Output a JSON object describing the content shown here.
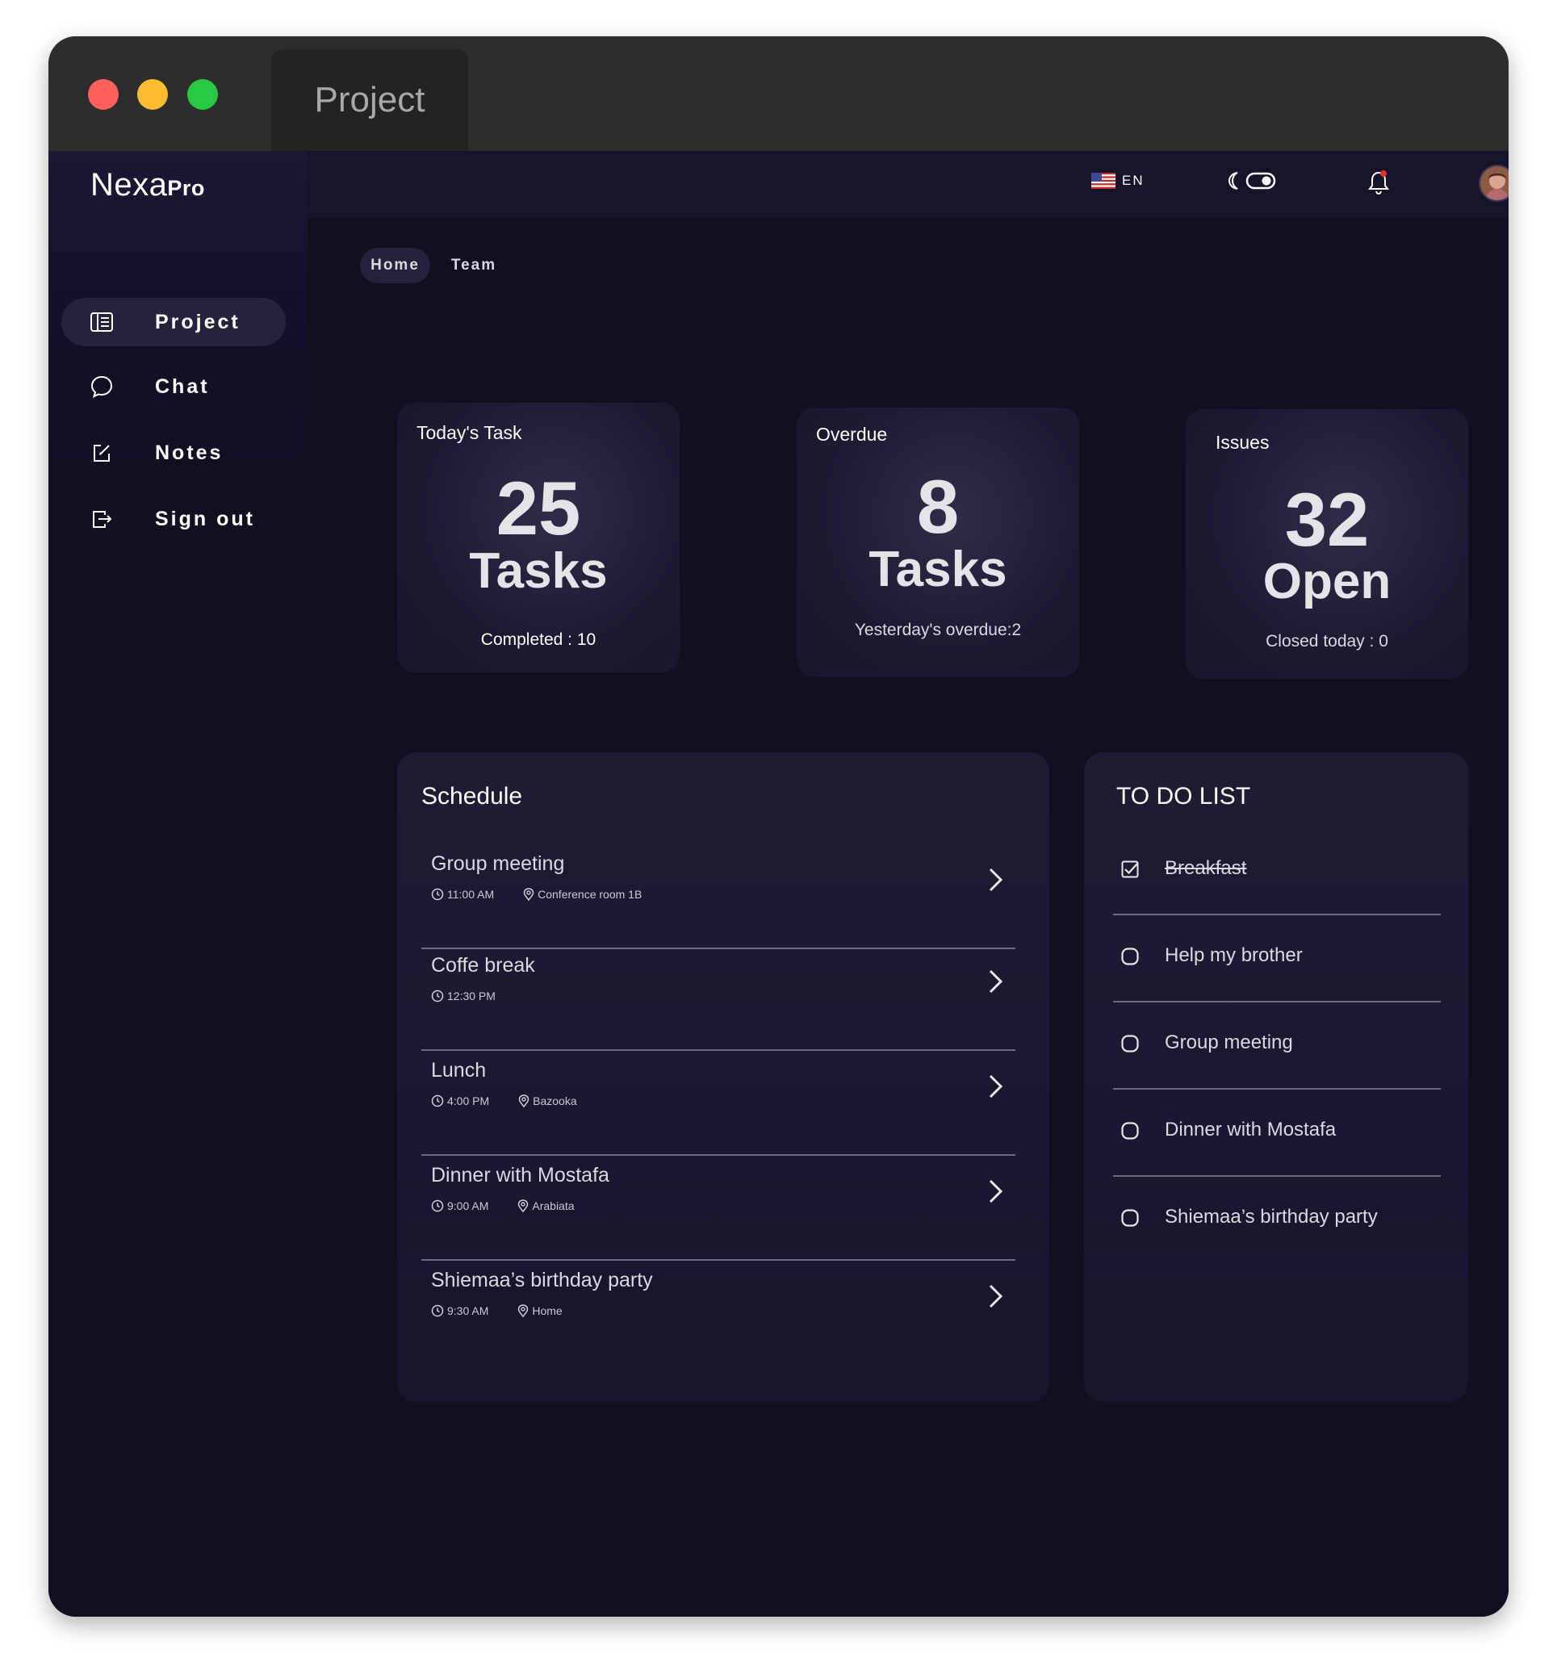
{
  "window": {
    "tab_title": "Project"
  },
  "sidebar": {
    "brand_main": "Nexa",
    "brand_suffix": "Pro",
    "items": [
      {
        "label": "Project",
        "icon": "project-icon",
        "active": true
      },
      {
        "label": "Chat",
        "icon": "chat-icon",
        "active": false
      },
      {
        "label": "Notes",
        "icon": "notes-icon",
        "active": false
      },
      {
        "label": "Sign out",
        "icon": "sign-out-icon",
        "active": false
      }
    ]
  },
  "topbar": {
    "language": "EN",
    "flag_icon": "us-flag-icon",
    "theme_icons": [
      "moon-icon",
      "toggle-icon"
    ],
    "notification_icon": "bell-icon",
    "notification_dot_color": "#e5322d",
    "avatar_icon": "avatar"
  },
  "breadcrumbs": [
    {
      "label": "Home",
      "active": true
    },
    {
      "label": "Team",
      "active": false
    }
  ],
  "stats": [
    {
      "title": "Today's Task",
      "number": "25",
      "unit": "Tasks",
      "footer": "Completed : 10"
    },
    {
      "title": "Overdue",
      "number": "8",
      "unit": "Tasks",
      "footer": "Yesterday's overdue:2"
    },
    {
      "title": "Issues",
      "number": "32",
      "unit": "Open",
      "footer": "Closed today : 0"
    }
  ],
  "schedule": {
    "title": "Schedule",
    "items": [
      {
        "title": "Group meeting",
        "time": "11:00 AM",
        "location": "Conference room 1B"
      },
      {
        "title": "Coffe break",
        "time": "12:30 PM",
        "location": ""
      },
      {
        "title": "Lunch",
        "time": "4:00 PM",
        "location": "Bazooka"
      },
      {
        "title": "Dinner with Mostafa",
        "time": "9:00 AM",
        "location": "Arabiata"
      },
      {
        "title": "Shiemaa’s birthday party",
        "time": "9:30 AM",
        "location": "Home"
      }
    ]
  },
  "todo": {
    "title": "TO DO LIST",
    "items": [
      {
        "label": "Breakfast",
        "done": true
      },
      {
        "label": "Help my brother",
        "done": false
      },
      {
        "label": "Group meeting",
        "done": false
      },
      {
        "label": "Dinner with Mostafa",
        "done": false
      },
      {
        "label": "Shiemaa’s birthday party",
        "done": false
      }
    ]
  },
  "colors": {
    "background": "#110f20",
    "sidebar_active": "#25233b",
    "traffic_red": "#fe5f57",
    "traffic_yellow": "#febc2e",
    "traffic_green": "#28c840"
  }
}
